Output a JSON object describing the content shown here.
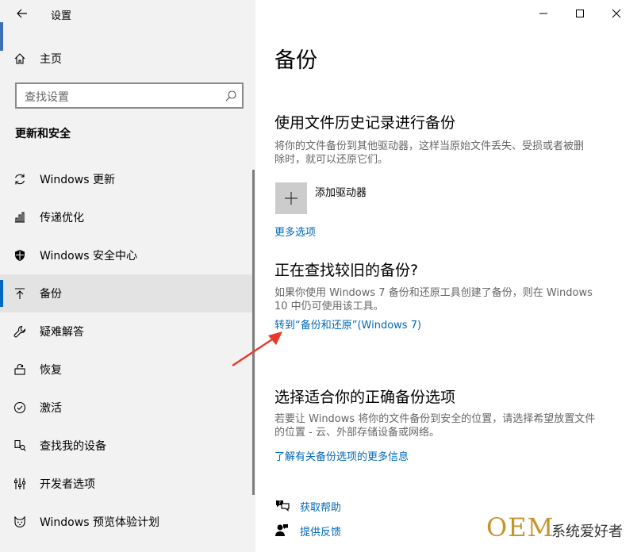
{
  "window": {
    "title": "设置"
  },
  "sidebar": {
    "home_label": "主页",
    "search_placeholder": "查找设置",
    "section_title": "更新和安全",
    "items": [
      {
        "label": "Windows 更新",
        "icon": "refresh-icon"
      },
      {
        "label": "传递优化",
        "icon": "delivery-optimization-icon"
      },
      {
        "label": "Windows 安全中心",
        "icon": "shield-icon"
      },
      {
        "label": "备份",
        "icon": "backup-arrow-icon",
        "selected": true
      },
      {
        "label": "疑难解答",
        "icon": "wrench-icon"
      },
      {
        "label": "恢复",
        "icon": "recovery-icon"
      },
      {
        "label": "激活",
        "icon": "check-circle-icon"
      },
      {
        "label": "查找我的设备",
        "icon": "find-device-icon"
      },
      {
        "label": "开发者选项",
        "icon": "developer-icon"
      },
      {
        "label": "Windows 预览体验计划",
        "icon": "insider-cat-icon"
      }
    ]
  },
  "main": {
    "title": "备份",
    "file_history": {
      "heading": "使用文件历史记录进行备份",
      "desc_line1": "将你的文件备份到其他驱动器，这样当原始文件丢失、受损或者被删",
      "desc_line2": "除时，就可以还原它们。",
      "add_drive_label": "添加驱动器",
      "more_options_link": "更多选项"
    },
    "older_backup": {
      "heading": "正在查找较旧的备份?",
      "desc_line1": "如果你使用 Windows 7 备份和还原工具创建了备份，则在 Windows",
      "desc_line2": "10 中仍可使用该工具。",
      "link": "转到“备份和还原”(Windows 7)"
    },
    "choose_options": {
      "heading": "选择适合你的正确备份选项",
      "desc_line1": "若要让 Windows 将你的文件备份到安全的位置，请选择希望放置文件",
      "desc_line2": "的位置 - 云、外部存储设备或网络。",
      "link": "了解有关备份选项的更多信息"
    },
    "footer": {
      "help_label": "获取帮助",
      "feedback_label": "提供反馈"
    }
  },
  "watermark": {
    "brand": "OEM",
    "text": "系统爱好者"
  },
  "colors": {
    "accent": "#0067b8",
    "annotation": "#e8392a",
    "watermark": "#c8922c"
  }
}
